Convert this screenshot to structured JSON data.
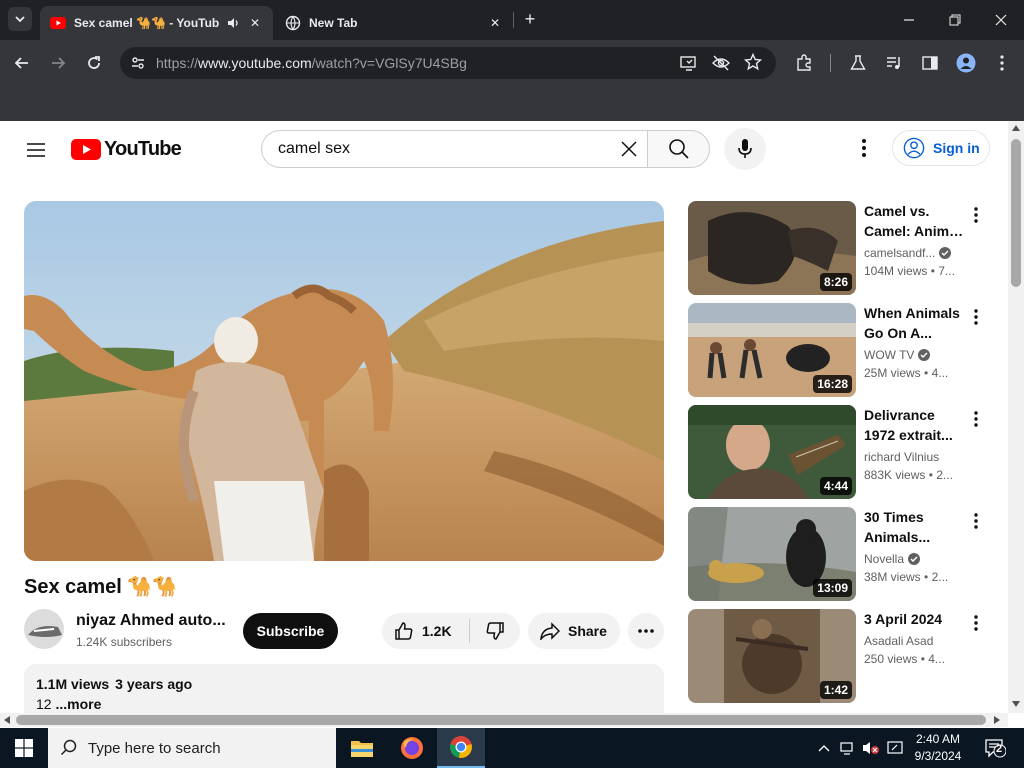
{
  "browser": {
    "tabs": [
      {
        "title": "Sex camel 🐪🐪 - YouTube",
        "active": true
      },
      {
        "title": "New Tab",
        "active": false
      }
    ],
    "url_scheme": "https://",
    "url_host": "www.youtube.com",
    "url_path": "/watch?v=VGlSy7U4SBg"
  },
  "youtube": {
    "logo_text": "YouTube",
    "search_query": "camel sex",
    "sign_in_label": "Sign in",
    "video": {
      "title": "Sex camel 🐪🐪",
      "channel_name": "niyaz Ahmed auto...",
      "subscribers": "1.24K subscribers",
      "subscribe_label": "Subscribe",
      "likes": "1.2K",
      "share_label": "Share",
      "views": "1.1M views",
      "age": "3 years ago",
      "description": "12",
      "more_label": "...more"
    },
    "recommendations": [
      {
        "line1": "Camel vs.",
        "line2": "Camel: Anima...",
        "channel": "camelsandf...",
        "verified": true,
        "views": "104M views",
        "age": "• 7...",
        "duration": "8:26"
      },
      {
        "line1": "When Animals",
        "line2": "Go On A...",
        "channel": "WOW TV",
        "verified": true,
        "views": "25M views",
        "age": "• 4...",
        "duration": "16:28"
      },
      {
        "line1": "Delivrance",
        "line2": "1972 extrait...",
        "channel": "richard Vilnius",
        "verified": false,
        "views": "883K views",
        "age": "• 2...",
        "duration": "4:44"
      },
      {
        "line1": "30 Times",
        "line2": "Animals...",
        "channel": "Novella",
        "verified": true,
        "views": "38M views",
        "age": "• 2...",
        "duration": "13:09"
      },
      {
        "line1": "3 April 2024",
        "line2": "",
        "channel": "Asadali Asad",
        "verified": false,
        "views": "250 views",
        "age": "• 4...",
        "duration": "1:42"
      }
    ]
  },
  "taskbar": {
    "search_placeholder": "Type here to search",
    "time": "2:40 AM",
    "date": "9/3/2024",
    "notification_count": "2"
  },
  "colors": {
    "chrome_dark": "#202124",
    "chrome_toolbar": "#35363a",
    "youtube_red": "#ff0000",
    "link_blue": "#065fd4",
    "taskbar": "#0b1623"
  }
}
